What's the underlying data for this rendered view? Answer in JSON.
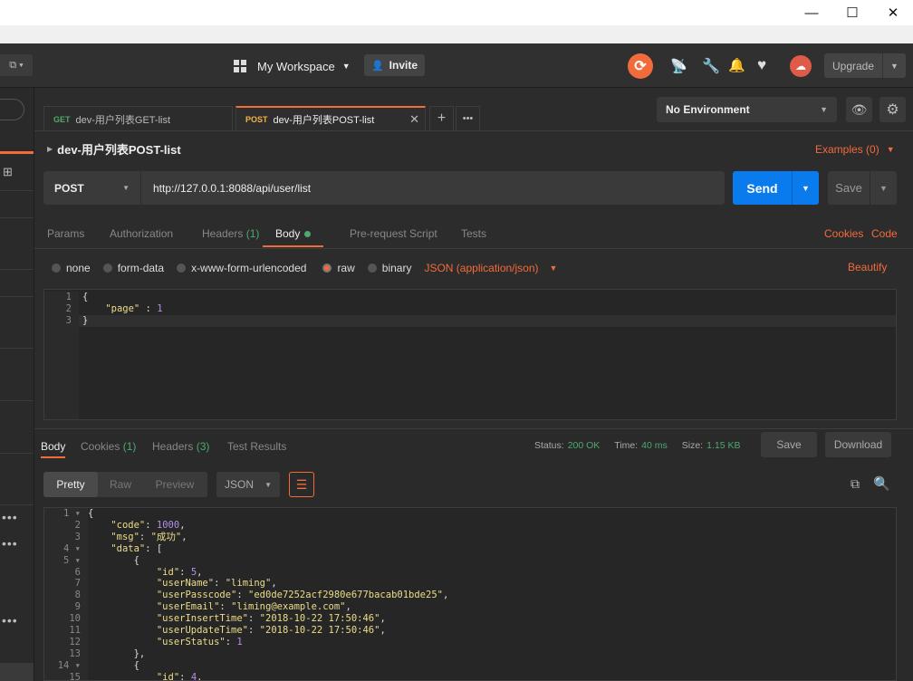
{
  "window": {
    "minimize": "—",
    "maximize": "☐",
    "close": "✕"
  },
  "header": {
    "workspace_label": "My Workspace",
    "invite_label": "Invite",
    "upgrade_label": "Upgrade"
  },
  "tabs": [
    {
      "method": "GET",
      "label": "dev-用户列表GET-list"
    },
    {
      "method": "POST",
      "label": "dev-用户列表POST-list"
    }
  ],
  "environment": {
    "selected": "No Environment"
  },
  "request": {
    "name": "dev-用户列表POST-list",
    "examples_label": "Examples (0)",
    "method": "POST",
    "url": "http://127.0.0.1:8088/api/user/list",
    "send_label": "Send",
    "save_label": "Save"
  },
  "request_tabs": {
    "params": "Params",
    "authorization": "Authorization",
    "headers": "Headers",
    "headers_count": "(1)",
    "body": "Body",
    "prerequest": "Pre-request Script",
    "tests": "Tests",
    "cookies": "Cookies",
    "code": "Code"
  },
  "body_modes": {
    "none": "none",
    "form_data": "form-data",
    "urlencoded": "x-www-form-urlencoded",
    "raw": "raw",
    "binary": "binary",
    "content_type": "JSON (application/json)",
    "beautify": "Beautify"
  },
  "request_body": {
    "lines": [
      "1",
      "2",
      "3"
    ],
    "l1": "{",
    "l2_key": "\"page\"",
    "l2_sep": " : ",
    "l2_val": "1",
    "l3": "}"
  },
  "response": {
    "tab_body": "Body",
    "tab_cookies": "Cookies",
    "cookies_count": "(1)",
    "tab_headers": "Headers",
    "headers_count": "(3)",
    "tab_tests": "Test Results",
    "status_label": "Status:",
    "status_value": "200 OK",
    "time_label": "Time:",
    "time_value": "40 ms",
    "size_label": "Size:",
    "size_value": "1.15 KB",
    "save_label": "Save",
    "download_label": "Download",
    "view_pretty": "Pretty",
    "view_raw": "Raw",
    "view_preview": "Preview",
    "format": "JSON"
  },
  "response_body": [
    {
      "n": "1",
      "t": [
        [
          "p",
          "{"
        ]
      ]
    },
    {
      "n": "2",
      "t": [
        [
          "p",
          "    "
        ],
        [
          "k",
          "\"code\""
        ],
        [
          "p",
          ": "
        ],
        [
          "n",
          "1000"
        ],
        [
          "p",
          ","
        ]
      ]
    },
    {
      "n": "3",
      "t": [
        [
          "p",
          "    "
        ],
        [
          "k",
          "\"msg\""
        ],
        [
          "p",
          ": "
        ],
        [
          "s",
          "\"成功\""
        ],
        [
          "p",
          ","
        ]
      ]
    },
    {
      "n": "4",
      "t": [
        [
          "p",
          "    "
        ],
        [
          "k",
          "\"data\""
        ],
        [
          "p",
          ": ["
        ]
      ]
    },
    {
      "n": "5",
      "t": [
        [
          "p",
          "        {"
        ]
      ]
    },
    {
      "n": "6",
      "t": [
        [
          "p",
          "            "
        ],
        [
          "k",
          "\"id\""
        ],
        [
          "p",
          ": "
        ],
        [
          "n",
          "5"
        ],
        [
          "p",
          ","
        ]
      ]
    },
    {
      "n": "7",
      "t": [
        [
          "p",
          "            "
        ],
        [
          "k",
          "\"userName\""
        ],
        [
          "p",
          ": "
        ],
        [
          "s",
          "\"liming\""
        ],
        [
          "p",
          ","
        ]
      ]
    },
    {
      "n": "8",
      "t": [
        [
          "p",
          "            "
        ],
        [
          "k",
          "\"userPasscode\""
        ],
        [
          "p",
          ": "
        ],
        [
          "s",
          "\"ed0de7252acf2980e677bacab01bde25\""
        ],
        [
          "p",
          ","
        ]
      ]
    },
    {
      "n": "9",
      "t": [
        [
          "p",
          "            "
        ],
        [
          "k",
          "\"userEmail\""
        ],
        [
          "p",
          ": "
        ],
        [
          "s",
          "\"liming@example.com\""
        ],
        [
          "p",
          ","
        ]
      ]
    },
    {
      "n": "10",
      "t": [
        [
          "p",
          "            "
        ],
        [
          "k",
          "\"userInsertTime\""
        ],
        [
          "p",
          ": "
        ],
        [
          "s",
          "\"2018-10-22 17:50:46\""
        ],
        [
          "p",
          ","
        ]
      ]
    },
    {
      "n": "11",
      "t": [
        [
          "p",
          "            "
        ],
        [
          "k",
          "\"userUpdateTime\""
        ],
        [
          "p",
          ": "
        ],
        [
          "s",
          "\"2018-10-22 17:50:46\""
        ],
        [
          "p",
          ","
        ]
      ]
    },
    {
      "n": "12",
      "t": [
        [
          "p",
          "            "
        ],
        [
          "k",
          "\"userStatus\""
        ],
        [
          "p",
          ": "
        ],
        [
          "n",
          "1"
        ]
      ]
    },
    {
      "n": "13",
      "t": [
        [
          "p",
          "        },"
        ]
      ]
    },
    {
      "n": "14",
      "t": [
        [
          "p",
          "        {"
        ]
      ]
    },
    {
      "n": "15",
      "t": [
        [
          "p",
          "            "
        ],
        [
          "k",
          "\"id\""
        ],
        [
          "p",
          ": "
        ],
        [
          "n",
          "4"
        ],
        [
          "p",
          ","
        ]
      ]
    }
  ],
  "colors": {
    "accent": "#f26b3a",
    "send": "#097bed",
    "ok": "#4ea96c"
  }
}
